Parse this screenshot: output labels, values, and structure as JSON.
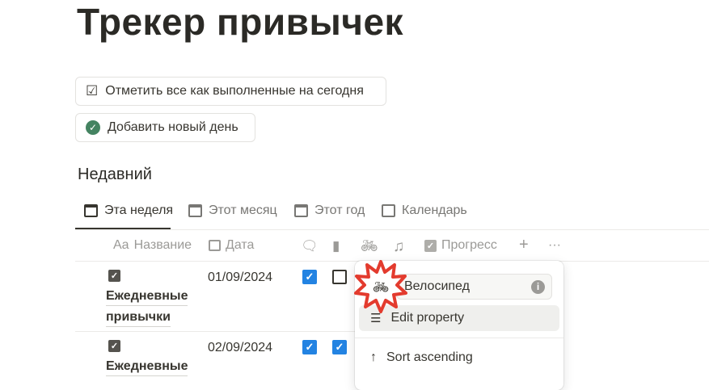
{
  "page": {
    "title": "Трекер привычек"
  },
  "buttons": {
    "mark_all": "Отметить все как выполненные на сегодня",
    "add_day": "Добавить новый день"
  },
  "section": {
    "title": "Недавний"
  },
  "tabs": [
    {
      "label": "Эта неделя"
    },
    {
      "label": "Этот месяц"
    },
    {
      "label": "Этот год"
    },
    {
      "label": "Календарь"
    }
  ],
  "columns": {
    "name_prefix": "Aa",
    "name": "Название",
    "date": "Дата",
    "progress": "Прогресс",
    "add": "+",
    "more": "···"
  },
  "rows": [
    {
      "name_line1": "Ежедневные",
      "name_line2": "привычки",
      "date": "01/09/2024",
      "c1": true,
      "c2": false
    },
    {
      "name_line1": "Ежедневные",
      "date": "02/09/2024",
      "c1": true,
      "c2": true
    }
  ],
  "menu": {
    "property_name": "Велосипед",
    "info": "i",
    "edit": "Edit property",
    "sort_asc": "Sort ascending"
  },
  "colors": {
    "accent": "#2383e2",
    "highlight": "#e33b2e",
    "green": "#448361"
  }
}
